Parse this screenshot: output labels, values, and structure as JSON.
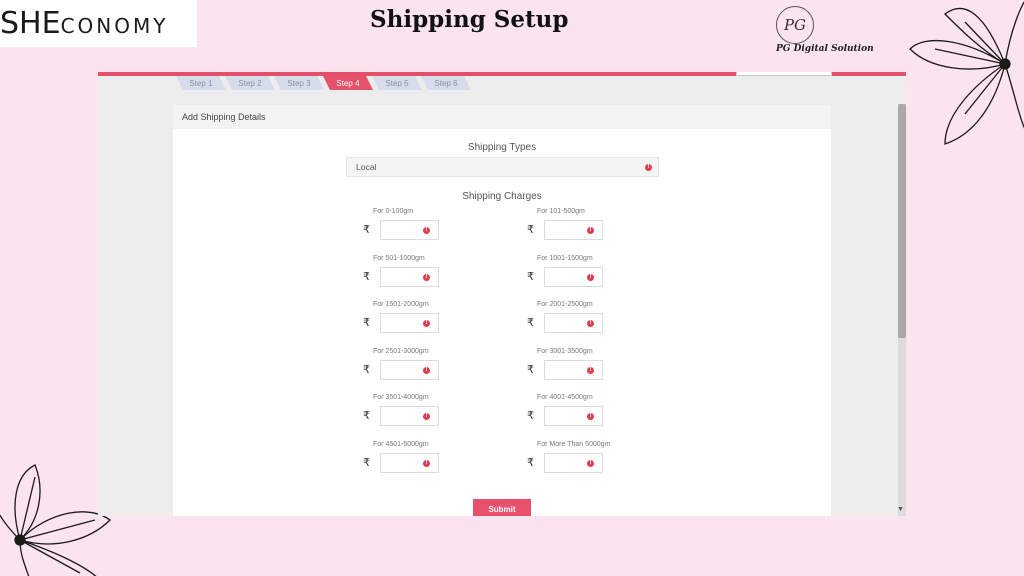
{
  "brand": {
    "logo_big": "SHE",
    "logo_small": "CONOMY"
  },
  "slide": {
    "title": "Shipping Setup"
  },
  "badge": {
    "initials": "PG",
    "caption": "PG Digital Solution"
  },
  "steps": [
    {
      "label": "Step 1",
      "active": false
    },
    {
      "label": "Step 2",
      "active": false
    },
    {
      "label": "Step 3",
      "active": false
    },
    {
      "label": "Step 4",
      "active": true
    },
    {
      "label": "Step 5",
      "active": false
    },
    {
      "label": "Step 6",
      "active": false
    }
  ],
  "card": {
    "header": "Add Shipping Details",
    "shipping_types_label": "Shipping Types",
    "shipping_type_value": "Local",
    "shipping_charges_label": "Shipping Charges",
    "currency_symbol": "₹",
    "charges": [
      {
        "label": "For 0-100gm",
        "value": ""
      },
      {
        "label": "For 101-500gm",
        "value": ""
      },
      {
        "label": "For 501-1000gm",
        "value": ""
      },
      {
        "label": "For 1001-1500gm",
        "value": ""
      },
      {
        "label": "For 1501-2000gm",
        "value": ""
      },
      {
        "label": "For 2001-2500gm",
        "value": ""
      },
      {
        "label": "For 2501-3000gm",
        "value": ""
      },
      {
        "label": "For 3001-3500gm",
        "value": ""
      },
      {
        "label": "For 3501-4000gm",
        "value": ""
      },
      {
        "label": "For 4001-4500gm",
        "value": ""
      },
      {
        "label": "For 4501-5000gm",
        "value": ""
      },
      {
        "label": "For More Than 5000gm",
        "value": ""
      }
    ],
    "submit_label": "Submit"
  },
  "colors": {
    "accent": "#e8506c",
    "background": "#fbe3f0",
    "error": "#e23c4f"
  },
  "icons": {
    "error": "error-icon",
    "rupee": "rupee-icon",
    "flower": "flower-icon"
  }
}
